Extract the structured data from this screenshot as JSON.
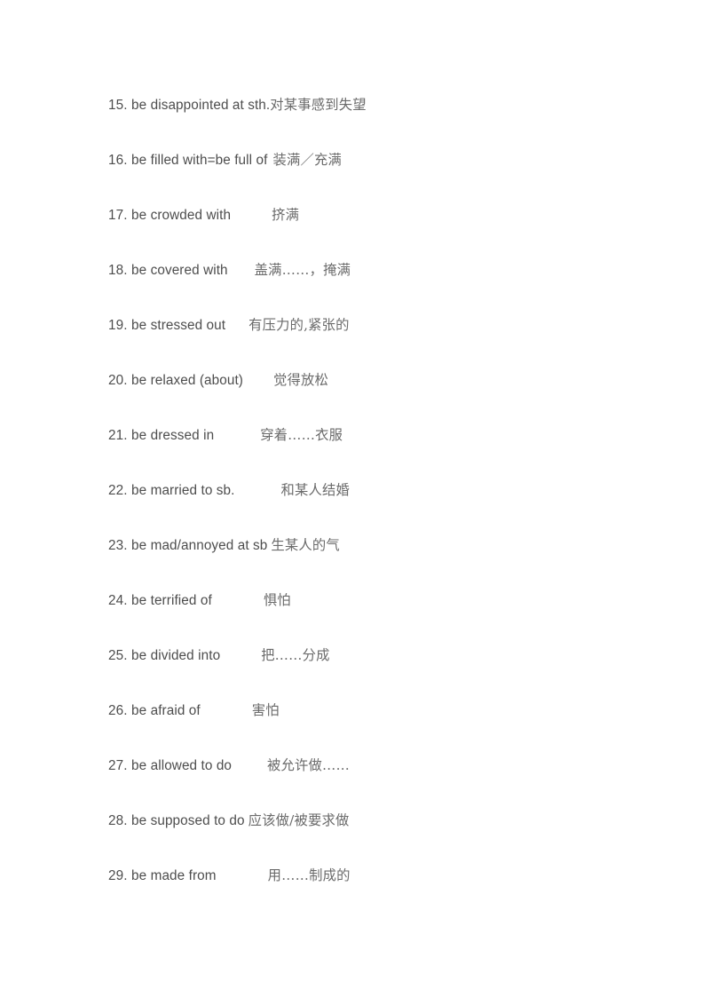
{
  "document": {
    "type": "phrase-list",
    "background_color": "#ffffff",
    "english_text_color": "#4d4d4d",
    "chinese_text_color": "#6b6b6b",
    "entries": [
      {
        "number": "15.",
        "english": "be disappointed at sth.",
        "chinese": "对某事感到失望",
        "gap": "gap-0"
      },
      {
        "number": "16.",
        "english": "be filled with=be full of",
        "chinese": "装满／充满",
        "gap": "gap-6"
      },
      {
        "number": "17.",
        "english": "be crowded with",
        "chinese": "挤满",
        "gap": "gap-46"
      },
      {
        "number": "18.",
        "english": "be covered with",
        "chinese": "盖满……，掩满",
        "gap": "gap-30"
      },
      {
        "number": "19.",
        "english": "be stressed out",
        "chinese": "有压力的,紧张的",
        "gap": "gap-26"
      },
      {
        "number": "20.",
        "english": "be relaxed (about)",
        "chinese": "觉得放松",
        "gap": "gap-34"
      },
      {
        "number": "21.",
        "english": "be dressed in",
        "chinese": "穿着……衣服",
        "gap": "gap-52"
      },
      {
        "number": "22.",
        "english": "be married to sb.",
        "chinese": "和某人结婚",
        "gap": "gap-52"
      },
      {
        "number": "23.",
        "english": "be mad/annoyed at sb",
        "chinese": "生某人的气",
        "gap": "gap-4"
      },
      {
        "number": "24.",
        "english": "be terrified of",
        "chinese": "惧怕",
        "gap": "gap-58"
      },
      {
        "number": "25.",
        "english": "be divided into",
        "chinese": "把……分成",
        "gap": "gap-46"
      },
      {
        "number": "26.",
        "english": "be afraid of",
        "chinese": "害怕",
        "gap": "gap-58"
      },
      {
        "number": "27.",
        "english": "be allowed to do",
        "chinese": "被允许做……",
        "gap": "gap-40"
      },
      {
        "number": "28.",
        "english": "be supposed to do",
        "chinese": "应该做/被要求做",
        "gap": "gap-4"
      },
      {
        "number": "29.",
        "english": "be made from",
        "chinese": "用……制成的",
        "gap": "gap-58"
      }
    ]
  }
}
